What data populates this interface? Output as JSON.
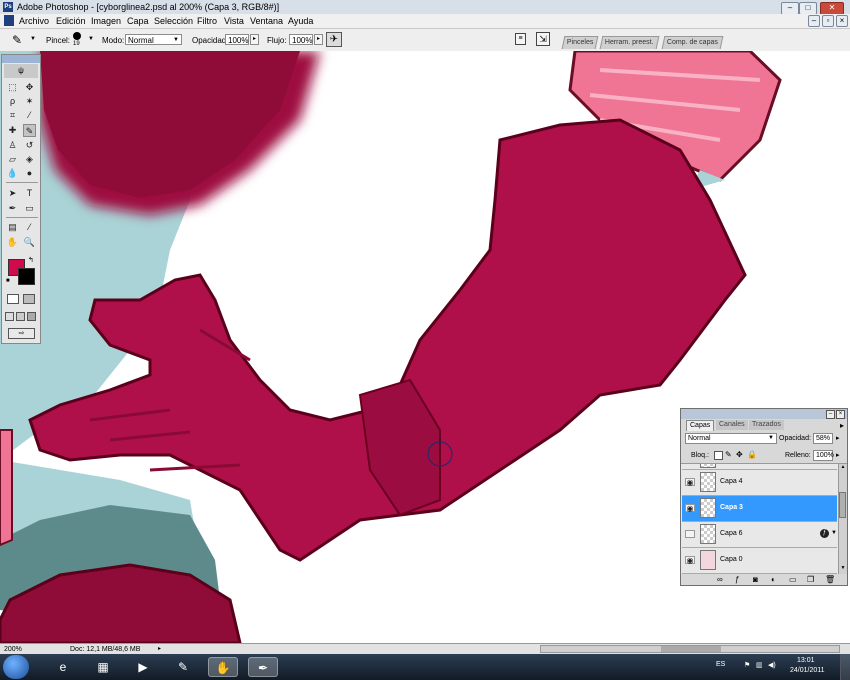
{
  "window": {
    "title": "Adobe Photoshop - [cyborglinea2.psd al 200% (Capa 3, RGB/8#)]",
    "app_icon": "Ps",
    "minimize_icon": "minimize-icon",
    "maximize_icon": "maximize-icon",
    "close_icon": "close-icon"
  },
  "menu": {
    "items": [
      "Archivo",
      "Edición",
      "Imagen",
      "Capa",
      "Selección",
      "Filtro",
      "Vista",
      "Ventana",
      "Ayuda"
    ]
  },
  "options": {
    "brush_label": "Pincel:",
    "brush_size": "19",
    "mode_label": "Modo:",
    "mode_value": "Normal",
    "opacity_label": "Opacidad:",
    "opacity_value": "100%",
    "flow_label": "Flujo:",
    "flow_value": "100%"
  },
  "palette_tabs": [
    "Pinceles",
    "Herram. preest.",
    "Comp. de capas"
  ],
  "colors": {
    "foreground": "#d10a4c",
    "background": "#000000",
    "glove": "#b0104a",
    "background_art": "#a9d3d6"
  },
  "layers": {
    "tabs": [
      "Capas",
      "Canales",
      "Trazados"
    ],
    "blend_mode": "Normal",
    "opacity_label": "Opacidad:",
    "opacity_value": "58%",
    "lock_label": "Bloq.:",
    "fill_label": "Relleno:",
    "fill_value": "100%",
    "items": [
      {
        "name": "Capa 4",
        "visible": true,
        "active": false
      },
      {
        "name": "Capa 3",
        "visible": true,
        "active": true
      },
      {
        "name": "Capa 6",
        "visible": false,
        "active": false
      },
      {
        "name": "Capa 0",
        "visible": true,
        "active": false
      }
    ]
  },
  "status": {
    "zoom": "200%",
    "doc": "Doc: 12,1 MB/48,6 MB"
  },
  "taskbar": {
    "language": "ES",
    "time": "13:01",
    "date": "24/01/2011"
  }
}
